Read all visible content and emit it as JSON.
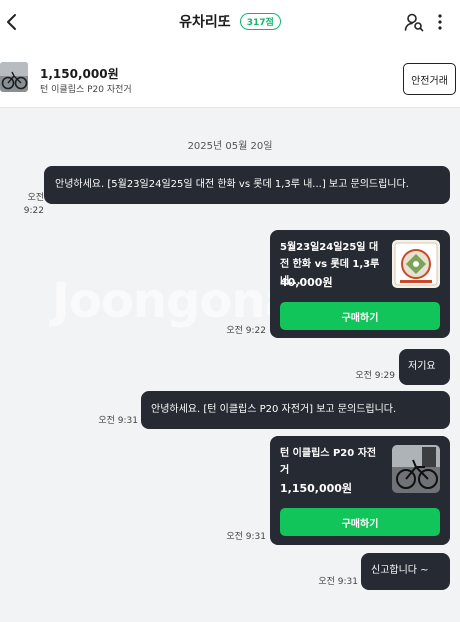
{
  "header": {
    "seller_name": "유차리또",
    "score_badge": "317점",
    "icons": [
      "chevron-left-icon",
      "user-search-icon",
      "more-vertical-icon"
    ]
  },
  "product": {
    "price": "1,150,000원",
    "name": "턴 이클립스 P20 자전거",
    "safe_trade_label": "안전거래"
  },
  "chat": {
    "watermark": "Joongonara",
    "date": "2025년 05월 20일",
    "messages": [
      {
        "time": "오전 9:22",
        "text": "안녕하세요. [5월23일24일25일 대전 한화 vs 롯데 1,3루 내...] 보고 문의드립니다."
      },
      {
        "time": "오전 9:22",
        "card_title": "5월23일24일25일 대전 한화 vs 롯데 1,3루 내...",
        "card_price": "40,000원",
        "button": "구매하기"
      },
      {
        "time": "오전 9:29",
        "text": "저기요"
      },
      {
        "time": "오전 9:31",
        "text": "안녕하세요. [턴 이클립스 P20 자전거] 보고 문의드립니다."
      },
      {
        "time": "오전 9:31",
        "card_title": "턴 이클립스 P20 자전거",
        "card_price": "1,150,000원",
        "button": "구매하기"
      },
      {
        "time": "오전 9:31",
        "text": "신고합니다 ~"
      }
    ]
  },
  "colors": {
    "accent": "#12c55a",
    "bubble": "#262b33",
    "background": "#f2f3f5"
  }
}
